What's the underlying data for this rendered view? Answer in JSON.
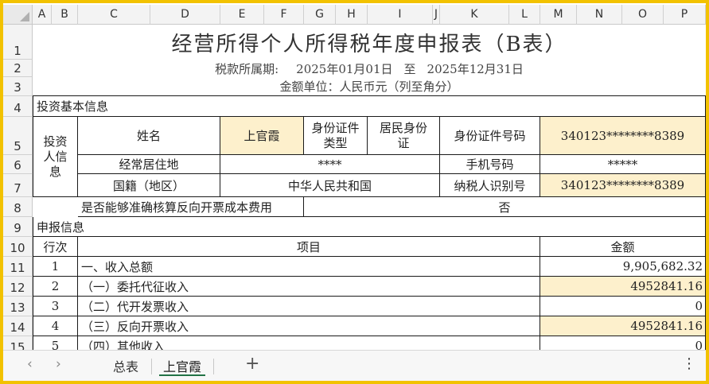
{
  "columns": [
    "A",
    "B",
    "C",
    "D",
    "E",
    "F",
    "G",
    "H",
    "I",
    "J",
    "K",
    "L",
    "M",
    "N",
    "O",
    "P"
  ],
  "rows": [
    "1",
    "2",
    "3",
    "4",
    "5",
    "6",
    "7",
    "8",
    "9",
    "10",
    "11",
    "12",
    "13",
    "14",
    "15"
  ],
  "title": "经营所得个人所得税年度申报表（B表）",
  "period": {
    "label": "税款所属期:",
    "start": "2025年01月01日",
    "to": "至",
    "end": "2025年12月31日"
  },
  "unit": "金额单位：人民币元（列至角分）",
  "investor_section": "投资基本信息",
  "investor": {
    "group_label": "投资人信息",
    "name_label": "姓名",
    "name_value": "上官霞",
    "id_type_label": "身份证件类型",
    "id_type_value": "居民身份证",
    "id_no_label": "身份证件号码",
    "id_no_value": "340123********8389",
    "residence_label": "经常居住地",
    "residence_value": "****",
    "phone_label": "手机号码",
    "phone_value": "*****",
    "nationality_label": "国籍（地区）",
    "nationality_value": "中华人民共和国",
    "taxpayer_id_label": "纳税人识别号",
    "taxpayer_id_value": "340123********8389",
    "reverse_label": "是否能够准确核算反向开票成本费用",
    "reverse_value": "否"
  },
  "report_section": "申报信息",
  "report_header": {
    "seq": "行次",
    "item": "项目",
    "amount": "金额"
  },
  "report_rows": [
    {
      "seq": "1",
      "item": "一、收入总额",
      "amount": "9,905,682.32",
      "highlight": false
    },
    {
      "seq": "2",
      "item": "（一）委托代征收入",
      "amount": "4952841.16",
      "highlight": true
    },
    {
      "seq": "3",
      "item": "（二）代开发票收入",
      "amount": "0",
      "highlight": false
    },
    {
      "seq": "4",
      "item": "（三）反向开票收入",
      "amount": "4952841.16",
      "highlight": true
    },
    {
      "seq": "5",
      "item": "（四）其他收入",
      "amount": "0",
      "highlight": false
    }
  ],
  "tabs": {
    "prev": "‹",
    "next": "›",
    "sheet1": "总表",
    "sheet2": "上官霞",
    "add": "+",
    "more": "⋮"
  },
  "colors": {
    "frame": "#f2c200",
    "highlight": "#fdf0cc",
    "active_tab": "#217346"
  }
}
